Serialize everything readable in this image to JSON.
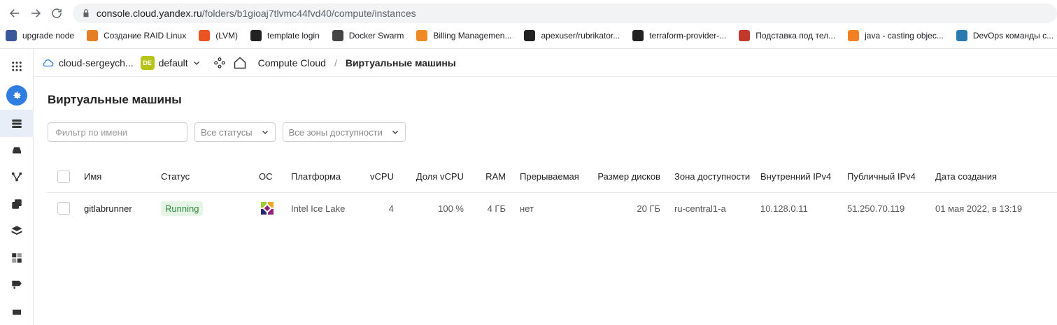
{
  "browser": {
    "url_host": "console.cloud.yandex.ru",
    "url_path": "/folders/b1gioaj7tlvmc44fvd40/compute/instances",
    "bookmarks": [
      {
        "label": "upgrade node",
        "icon": "wordpress-icon",
        "color": "#3b5998"
      },
      {
        "label": "Создание RAID Linux",
        "icon": "dm-icon",
        "color": "#e67e22"
      },
      {
        "label": "(LVM)",
        "icon": "ubuntu-icon",
        "color": "#e95420"
      },
      {
        "label": "template login",
        "icon": "codepen-icon",
        "color": "#222222"
      },
      {
        "label": "Docker Swarm",
        "icon": "docker-icon",
        "color": "#444444"
      },
      {
        "label": "Billing Managemen...",
        "icon": "aws-cube-icon",
        "color": "#f08a24"
      },
      {
        "label": "apexuser/rubrikator...",
        "icon": "github-icon",
        "color": "#222222"
      },
      {
        "label": "terraform-provider-...",
        "icon": "github-icon",
        "color": "#222222"
      },
      {
        "label": "Подставка под тел...",
        "icon": "ozon-icon",
        "color": "#c0392b"
      },
      {
        "label": "java - casting objec...",
        "icon": "stackoverflow-icon",
        "color": "#f48024"
      },
      {
        "label": "DevOps команды с...",
        "icon": "devops-icon",
        "color": "#2a7ab0"
      }
    ]
  },
  "header": {
    "cloud_name": "cloud-sergeych...",
    "folder_badge": "DE",
    "folder_name": "default",
    "service": "Compute Cloud",
    "separator": "/",
    "current": "Виртуальные машины"
  },
  "page": {
    "title": "Виртуальные машины",
    "filter_placeholder": "Фильтр по имени",
    "status_filter": "Все статусы",
    "zone_filter": "Все зоны доступности"
  },
  "table": {
    "columns": [
      "Имя",
      "Статус",
      "ОС",
      "Платформа",
      "vCPU",
      "Доля vCPU",
      "RAM",
      "Прерываемая",
      "Размер дисков",
      "Зона доступности",
      "Внутренний IPv4",
      "Публичный IPv4",
      "Дата создания"
    ],
    "rows": [
      {
        "name": "gitlabrunner",
        "status": "Running",
        "os": "centos-icon",
        "platform": "Intel Ice Lake",
        "vcpu": "4",
        "vcpu_share": "100 %",
        "ram": "4 ГБ",
        "preemptible": "нет",
        "disk_size": "20 ГБ",
        "zone": "ru-central1-a",
        "internal_ip": "10.128.0.11",
        "public_ip": "51.250.70.119",
        "created": "01 мая 2022, в 13:19"
      }
    ]
  },
  "colors": {
    "accent": "#2f7de1",
    "running_bg": "#e6f4e6",
    "running_fg": "#2e8b3e",
    "folder_badge": "#b7c316"
  }
}
